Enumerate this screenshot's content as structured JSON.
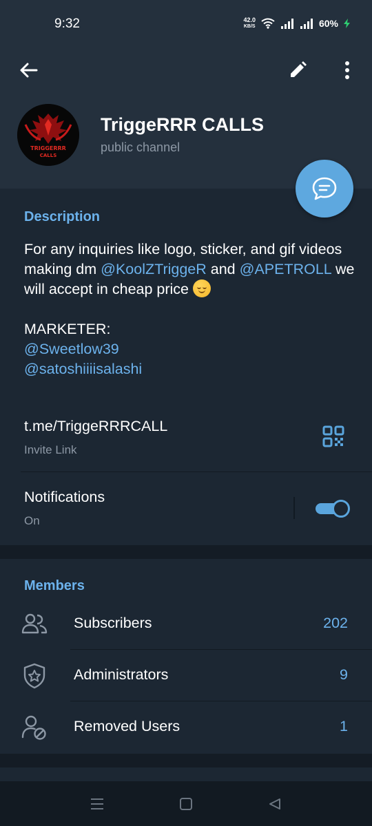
{
  "status_bar": {
    "time": "9:32",
    "net_speed_value": "42.0",
    "net_speed_unit": "KB/S",
    "battery": "60%"
  },
  "header": {
    "channel_name": "TriggeRRR CALLS",
    "channel_type": "public channel",
    "avatar_text_line1": "TRIGGERRR",
    "avatar_text_line2": "CALLS"
  },
  "description": {
    "title": "Description",
    "text_1": "For any inquiries like logo, sticker, and gif videos making dm ",
    "mention_1": "@KoolZTriggeR",
    "text_2": " and ",
    "mention_2": "@APETROLL",
    "text_3": " we will accept in cheap price ",
    "marketer_label": "MARKETER:",
    "marketer_1": "@Sweetlow39",
    "marketer_2": "@satoshiiiisalashi"
  },
  "invite": {
    "link": "t.me/TriggeRRRCALL",
    "label": "Invite Link"
  },
  "notifications": {
    "label": "Notifications",
    "state": "On",
    "enabled": true
  },
  "members": {
    "title": "Members",
    "rows": [
      {
        "label": "Subscribers",
        "count": "202",
        "icon": "users-icon"
      },
      {
        "label": "Administrators",
        "count": "9",
        "icon": "shield-star-icon"
      },
      {
        "label": "Removed Users",
        "count": "1",
        "icon": "user-blocked-icon"
      }
    ]
  },
  "colors": {
    "background": "#1c2733",
    "header": "#24303d",
    "accent": "#6cb2ec",
    "fab": "#5ea8df",
    "secondary_text": "#8d98a5"
  }
}
